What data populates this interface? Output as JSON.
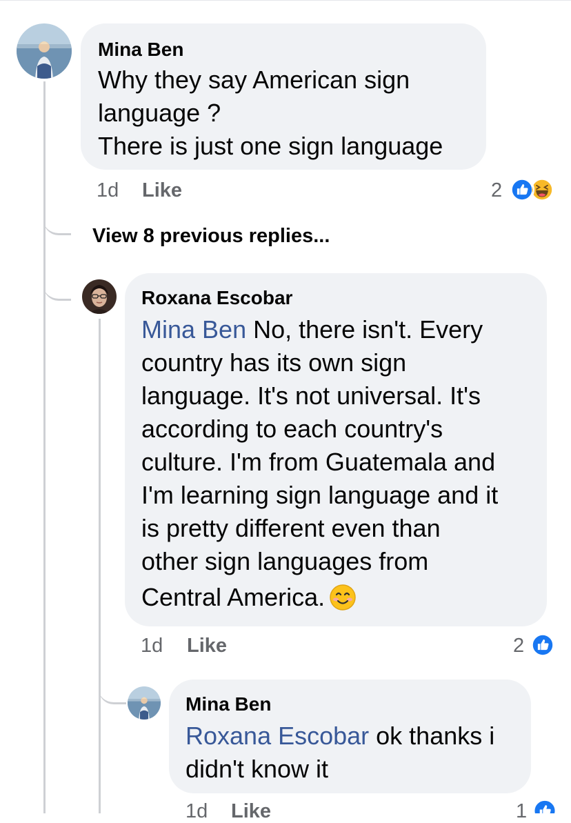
{
  "comments": [
    {
      "author": "Mina Ben",
      "lines": [
        "Why they say  American sign",
        "language ?",
        "There is just one sign language"
      ],
      "time": "1d",
      "like_label": "Like",
      "reaction_count": "2",
      "reactions": [
        "like-icon",
        "haha-icon"
      ]
    }
  ],
  "view_previous_replies": "View 8 previous replies...",
  "replies": [
    {
      "author": "Roxana Escobar",
      "mention": "Mina Ben",
      "lines": [
        " No, there isn't. Every",
        "country has its own sign",
        "language. It's not universal. It's",
        "according to each country's",
        "culture. I'm from Guatemala and",
        "I'm learning sign language and it",
        "is pretty different even than",
        "other sign languages from",
        "Central America."
      ],
      "trailing_emoji": "smiling-face-emoji",
      "time": "1d",
      "like_label": "Like",
      "reaction_count": "2",
      "reactions": [
        "like-icon"
      ]
    },
    {
      "author": "Mina Ben",
      "mention": "Roxana Escobar",
      "lines": [
        " ok thanks i",
        "didn't know it"
      ],
      "time": "1d",
      "like_label": "Like",
      "reaction_count": "1",
      "reactions": [
        "like-icon"
      ]
    }
  ],
  "colors": {
    "bubble": "#f0f2f5",
    "mention": "#385898",
    "meta": "#65676b",
    "like_blue": "#1877f2",
    "haha_yellow": "#f7b928",
    "thread_line": "#ced0d4"
  }
}
